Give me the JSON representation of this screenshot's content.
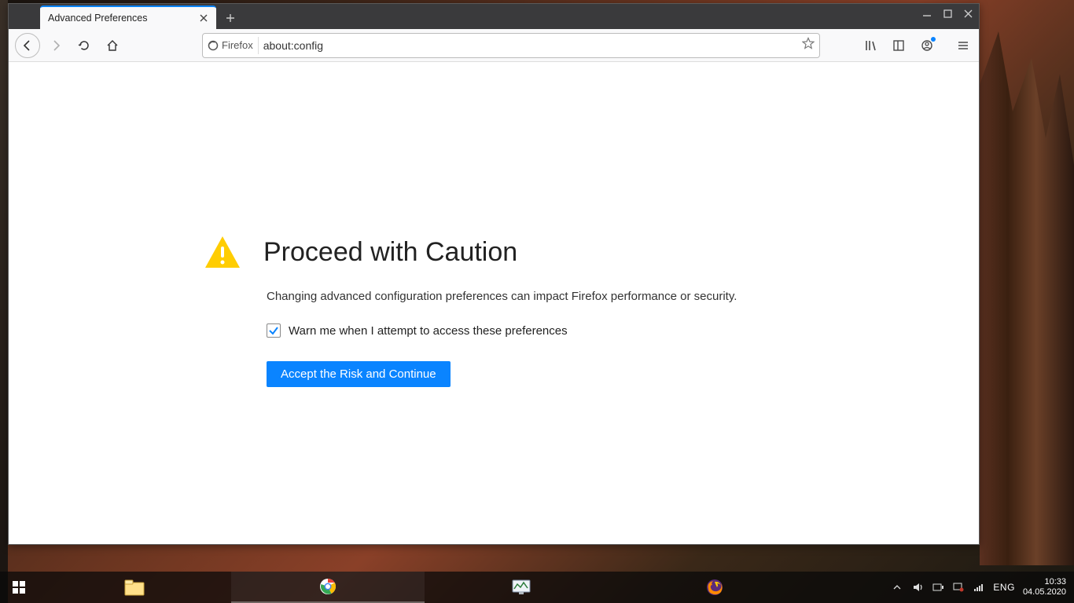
{
  "window": {
    "controls": {
      "min": "—",
      "max": "▢",
      "close": "✕"
    }
  },
  "tab": {
    "title": "Advanced Preferences"
  },
  "toolbar": {
    "identity_label": "Firefox",
    "url": "about:config"
  },
  "content": {
    "title": "Proceed with Caution",
    "description": "Changing advanced configuration preferences can impact Firefox performance or security.",
    "checkbox_label": "Warn me when I attempt to access these preferences",
    "checkbox_checked": true,
    "accept_button": "Accept the Risk and Continue"
  },
  "taskbar": {
    "lang": "ENG",
    "time": "10:33",
    "date": "04.05.2020"
  }
}
